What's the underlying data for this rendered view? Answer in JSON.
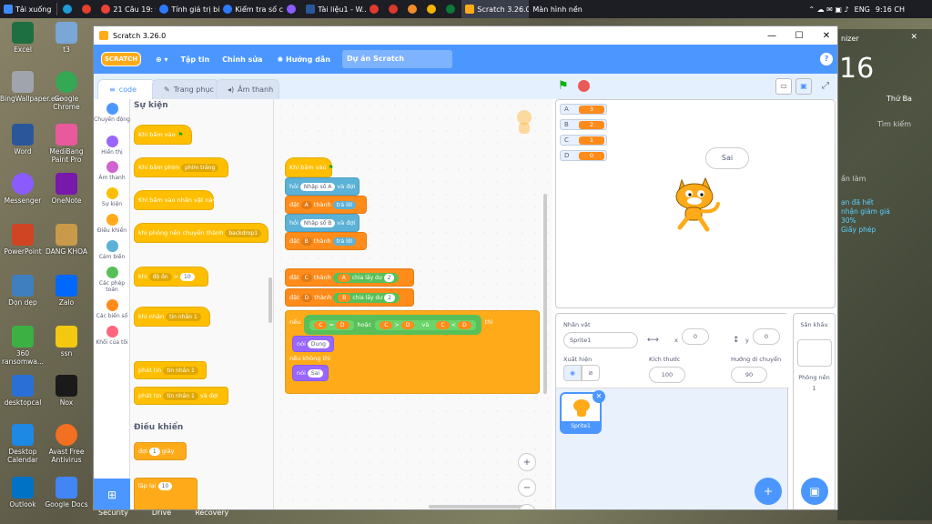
{
  "taskbar": {
    "items": [
      "Tải xuống",
      "21 Câu 19: Đ...",
      "Tính giá trị bi...",
      "Kiểm tra số c...",
      "Tài liệu1 - W...",
      "Scratch 3.26.0",
      "Màn hình nền"
    ],
    "lang": "ENG",
    "time": "9:16 CH"
  },
  "desktop": {
    "icons": [
      "Excel",
      "t3",
      "BingWallpaper.exe",
      "Google Chrome",
      "Word",
      "MediBang Paint Pro",
      "Messenger",
      "OneNote",
      "PowerPoint",
      "DANG KHOA",
      "Dọn dẹp",
      "Zalo",
      "360 ransomwa...",
      "ssn",
      "desktopcal",
      "Nox",
      "Desktop Calendar",
      "Avast Free Antivirus",
      "Outlook",
      "Google Docs"
    ],
    "bottom": [
      "Security",
      "Drive",
      "Recovery"
    ]
  },
  "rightpanel": {
    "top": "nizer",
    "big": "16",
    "day": "Thứ Ba",
    "search": "Tìm kiếm",
    "lam": "ần làm",
    "promo1": "ạn đã hết",
    "promo2": "nhận giảm giá",
    "promo3": "30%",
    "promo4": "Giấy phép"
  },
  "window": {
    "title": "Scratch 3.26.0",
    "min": "—",
    "max": "☐",
    "close": "✕"
  },
  "menu": {
    "logo": "SCRATCH",
    "file": "Tập tin",
    "edit": "Chỉnh sửa",
    "tutorial": "Hướng dẫn",
    "project": "Dự án Scratch",
    "help": "?"
  },
  "tabs": {
    "code": "code",
    "costumes": "Trang phục",
    "sounds": "Âm thanh"
  },
  "categories": [
    {
      "label": "Chuyển động",
      "color": "#4c97ff"
    },
    {
      "label": "Hiển thị",
      "color": "#9966ff"
    },
    {
      "label": "Âm thanh",
      "color": "#cf63cf"
    },
    {
      "label": "Sự kiện",
      "color": "#ffbf00"
    },
    {
      "label": "Điều khiển",
      "color": "#ffab19"
    },
    {
      "label": "Cảm biến",
      "color": "#5cb1d6"
    },
    {
      "label": "Các phép toán",
      "color": "#59c059"
    },
    {
      "label": "Các biến số",
      "color": "#ff8c1a"
    },
    {
      "label": "Khối của tôi",
      "color": "#ff6680"
    }
  ],
  "palette": {
    "events_title": "Sự kiện",
    "control_title": "Điều khiển",
    "b1": "Khi bấm vào",
    "b2": "Khi bấm phím",
    "b2d": "phím trắng",
    "b3": "Khi bấm vào nhân vật này",
    "b4": "khi phông nền chuyển thành",
    "b4d": "backdrop1",
    "b5": "khi",
    "b5d": "độ ồn",
    "b5op": ">",
    "b5v": "10",
    "b6": "khi nhận",
    "b6d": "tin nhắn 1",
    "b7": "phát tin",
    "b7d": "tin nhắn 1",
    "b8": "phát tin",
    "b8d": "tin nhắn 1",
    "b8s": "và đợi",
    "c1": "đợi",
    "c1v": "1",
    "c1s": "giây",
    "c2": "lặp lại",
    "c2v": "10"
  },
  "script": {
    "hat": "Khi bấm vào",
    "ask1": "hỏi",
    "ask1v": "Nhập số A",
    "ask1s": "và đợi",
    "set1": "đặt",
    "set1d": "A",
    "set1t": "thành",
    "set1r": "trả lời",
    "ask2": "hỏi",
    "ask2v": "Nhập số B",
    "ask2s": "và đợi",
    "set2": "đặt",
    "set2d": "B",
    "set2t": "thành",
    "set2r": "trả lời",
    "set3": "đặt",
    "set3d": "C",
    "set3t": "thành",
    "set3a": "A",
    "set3m": "chia lấy dư",
    "set3n": "2",
    "set4": "đặt",
    "set4d": "D",
    "set4t": "thành",
    "set4a": "B",
    "set4m": "chia lấy dư",
    "set4n": "2",
    "if": "nếu",
    "c1": "C",
    "eq1": "=",
    "d1": "D",
    "or": "hoặc",
    "c2": "C",
    ">": ">",
    "d2": "D",
    "and": "và",
    "c3": "C",
    "lt": "<",
    "d3": "D",
    "then": "thì",
    "say1": "nói",
    "say1v": "Dung",
    "else": "nếu không thì",
    "say2": "nói",
    "say2v": "Sai"
  },
  "zoom": {
    "in": "+",
    "out": "−",
    "reset": "="
  },
  "stage": {
    "bubble": "Sai",
    "monitors": [
      {
        "name": "A",
        "value": "3"
      },
      {
        "name": "B",
        "value": "2"
      },
      {
        "name": "C",
        "value": "1"
      },
      {
        "name": "D",
        "value": "0"
      }
    ]
  },
  "sprite": {
    "label_name": "Nhân vật",
    "name": "Sprite1",
    "x_label": "x",
    "x": "0",
    "y_label": "y",
    "y": "0",
    "show_label": "Xuất hiện",
    "size_label": "Kích thước",
    "size": "100",
    "dir_label": "Hướng di chuyển",
    "dir": "90",
    "thumb_label": "Sprite1"
  },
  "stagepane": {
    "title": "Sân khấu",
    "backdrops_label": "Phông nền",
    "backdrops": "1"
  }
}
